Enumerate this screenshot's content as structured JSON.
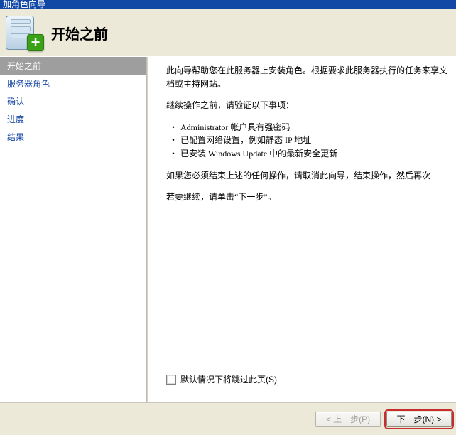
{
  "window": {
    "title_fragment": "加角色向导"
  },
  "header": {
    "title": "开始之前"
  },
  "sidebar": {
    "items": [
      {
        "label": "开始之前",
        "active": true
      },
      {
        "label": "服务器角色"
      },
      {
        "label": "确认"
      },
      {
        "label": "进度"
      },
      {
        "label": "结果"
      }
    ]
  },
  "content": {
    "intro": "此向导帮助您在此服务器上安装角色。根据要求此服务器执行的任务来享文档或主持网站。",
    "verify_heading": "继续操作之前，请验证以下事项：",
    "verify_items": [
      "Administrator 帐户具有强密码",
      "已配置网络设置，例如静态 IP 地址",
      "已安装 Windows Update 中的最新安全更新"
    ],
    "cancel_note": "如果您必须结束上述的任何操作，请取消此向导，结束操作，然后再次",
    "continue_note": "若要继续，请单击“下一步”。",
    "skip_checkbox_label": "默认情况下将跳过此页(S)"
  },
  "footer": {
    "prev": "< 上一步(P)",
    "next": "下一步(N) >"
  }
}
